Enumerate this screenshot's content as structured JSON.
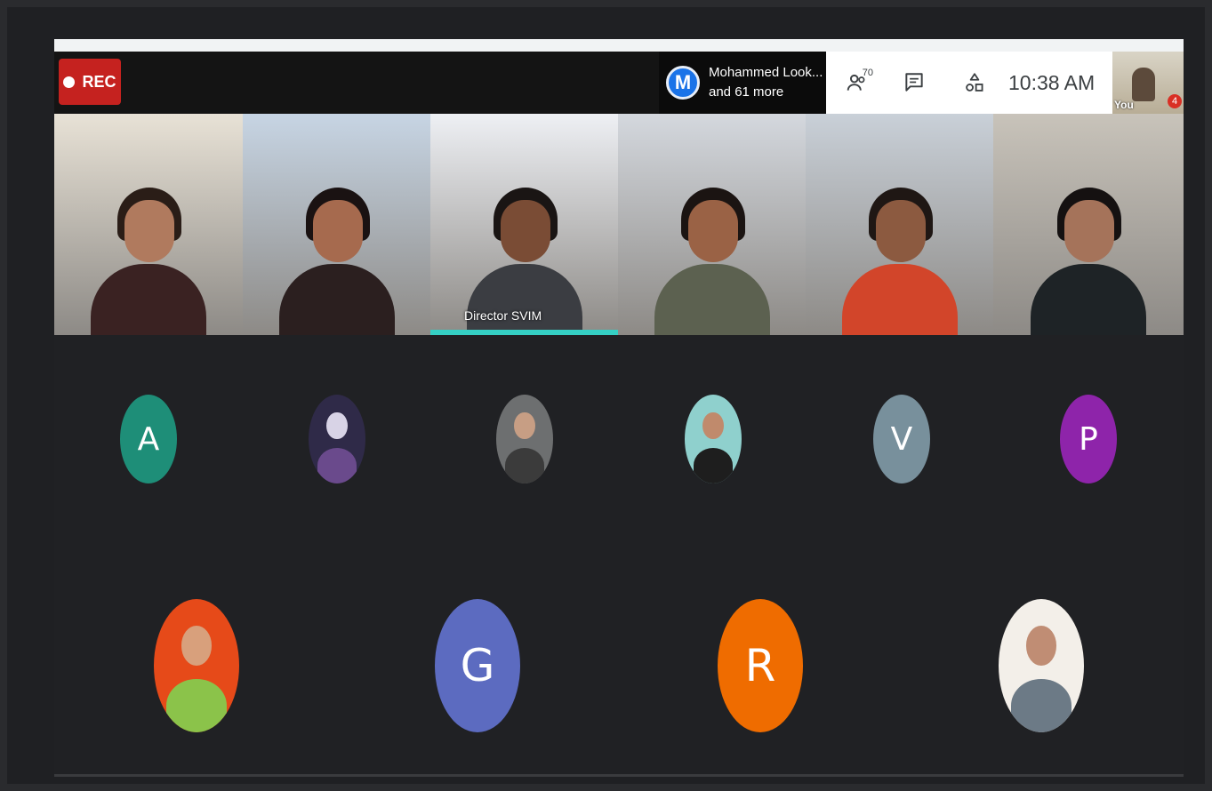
{
  "recording": {
    "label": "REC"
  },
  "presenter": {
    "name": "Mohammed Look...",
    "more": "and 61 more",
    "logo_letter": "M"
  },
  "toolbar": {
    "people_count": "70",
    "time": "10:38 AM"
  },
  "self_view": {
    "label": "You",
    "hand_count": "4"
  },
  "video_tiles": [
    {
      "id": "tile-1",
      "bg": "#e8e2d6",
      "skin": "#b07a5e",
      "hair": "#2a1d17",
      "shirt": "#3a2222"
    },
    {
      "id": "tile-2",
      "bg": "#c7d5e4",
      "skin": "#a66a4e",
      "hair": "#1a1212",
      "shirt": "#2b1f1f"
    },
    {
      "id": "tile-3",
      "bg": "#eef0f4",
      "skin": "#7a4c35",
      "hair": "#1a1514",
      "shirt": "#3b3d42",
      "label": "Director SVIM",
      "speaking": true
    },
    {
      "id": "tile-4",
      "bg": "#d4d8de",
      "skin": "#9a6245",
      "hair": "#1b1412",
      "shirt": "#5c6150"
    },
    {
      "id": "tile-5",
      "bg": "#c9d0d8",
      "skin": "#8c5a40",
      "hair": "#1f1714",
      "shirt": "#d2452a"
    },
    {
      "id": "tile-6",
      "bg": "#c8c3ba",
      "skin": "#a5735a",
      "hair": "#151111",
      "shirt": "#1e2326"
    }
  ],
  "avatars_row1": [
    {
      "letter": "A",
      "color": "#1e8e78"
    },
    {
      "photo": true,
      "colors": [
        "#2f2a48",
        "#d8d3e6",
        "#6a4a8c"
      ]
    },
    {
      "photo": true,
      "colors": [
        "#6d6f70",
        "#c79e84",
        "#3b3b3b"
      ]
    },
    {
      "photo": true,
      "colors": [
        "#8fd0cd",
        "#c08a6c",
        "#1e1e1e"
      ]
    },
    {
      "letter": "V",
      "color": "#78909c"
    },
    {
      "letter": "P",
      "color": "#8e24aa"
    }
  ],
  "avatars_row2": [
    {
      "photo": true,
      "colors": [
        "#e64a19",
        "#d8a07c",
        "#8bc34a"
      ]
    },
    {
      "letter": "G",
      "color": "#5c6bc0"
    },
    {
      "letter": "R",
      "color": "#ef6c00"
    },
    {
      "photo": true,
      "colors": [
        "#f3efe9",
        "#c08d74",
        "#6c7a86"
      ]
    }
  ]
}
